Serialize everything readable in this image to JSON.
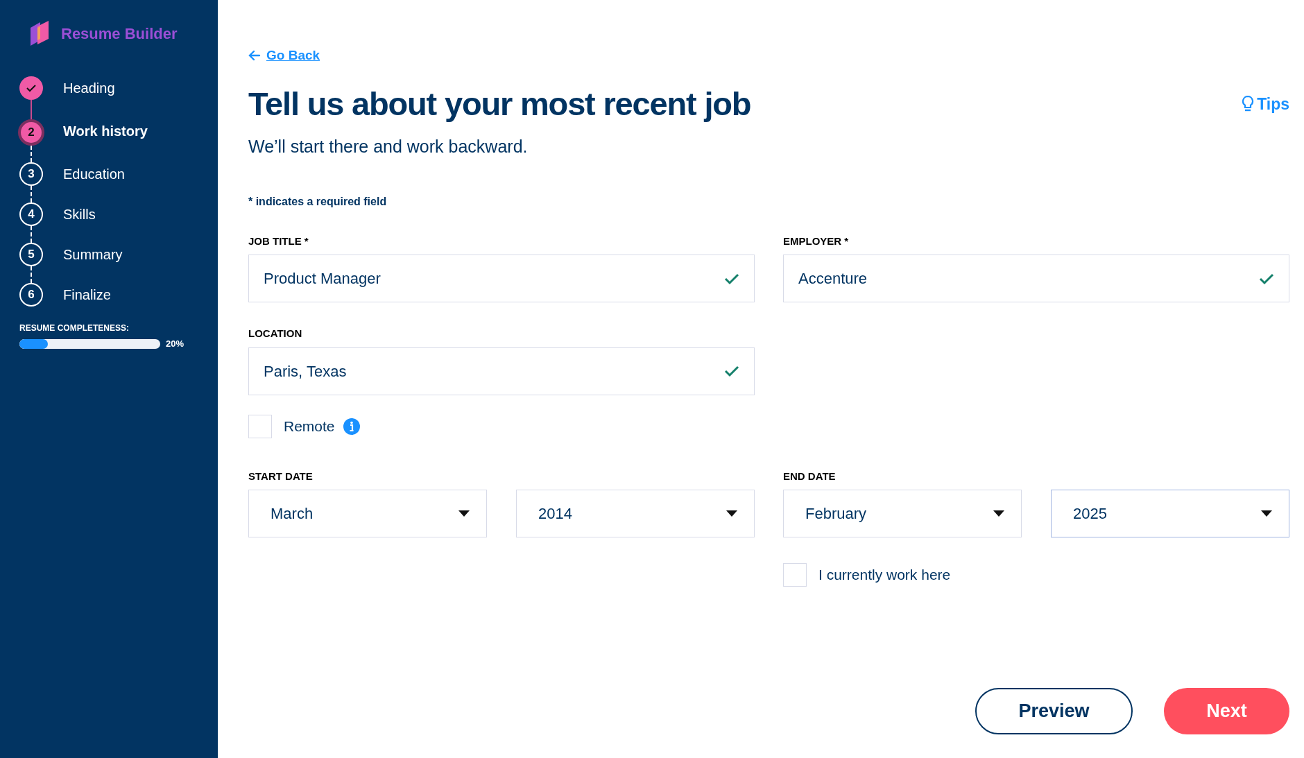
{
  "brand": {
    "name": "Resume Builder"
  },
  "steps": [
    {
      "label": "Heading",
      "completed": true,
      "selected": false
    },
    {
      "number": "2",
      "label": "Work history",
      "completed": false,
      "selected": true
    },
    {
      "number": "3",
      "label": "Education",
      "completed": false,
      "selected": false
    },
    {
      "number": "4",
      "label": "Skills",
      "completed": false,
      "selected": false
    },
    {
      "number": "5",
      "label": "Summary",
      "completed": false,
      "selected": false
    },
    {
      "number": "6",
      "label": "Finalize",
      "completed": false,
      "selected": false
    }
  ],
  "completeness": {
    "label": "RESUME COMPLETENESS:",
    "level": 0.2,
    "reading": "20%"
  },
  "back_link": "Go Back",
  "tips_link": "Tips",
  "title": "Tell us about your most recent job",
  "subtitle": "We’ll start there and work backward.",
  "required_note": "* indicates a required field",
  "fields": [
    {
      "label": "JOB TITLE *",
      "value": "Product Manager",
      "valid": true
    },
    {
      "label": "EMPLOYER *",
      "value": "Accenture",
      "valid": true
    },
    {
      "label": "LOCATION",
      "value": "Paris, Texas",
      "valid": true
    }
  ],
  "remote": {
    "label": "Remote",
    "checked": false
  },
  "start_date": {
    "label": "START DATE",
    "month": {
      "value": "March",
      "focused": false
    },
    "year": {
      "value": "2014",
      "focused": false
    }
  },
  "end_date": {
    "label": "END DATE",
    "month": {
      "value": "February",
      "focused": false
    },
    "year": {
      "value": "2025",
      "focused": true
    }
  },
  "current_job": {
    "label": "I currently work here",
    "checked": false
  },
  "buttons": {
    "preview": "Preview",
    "next": "Next"
  }
}
